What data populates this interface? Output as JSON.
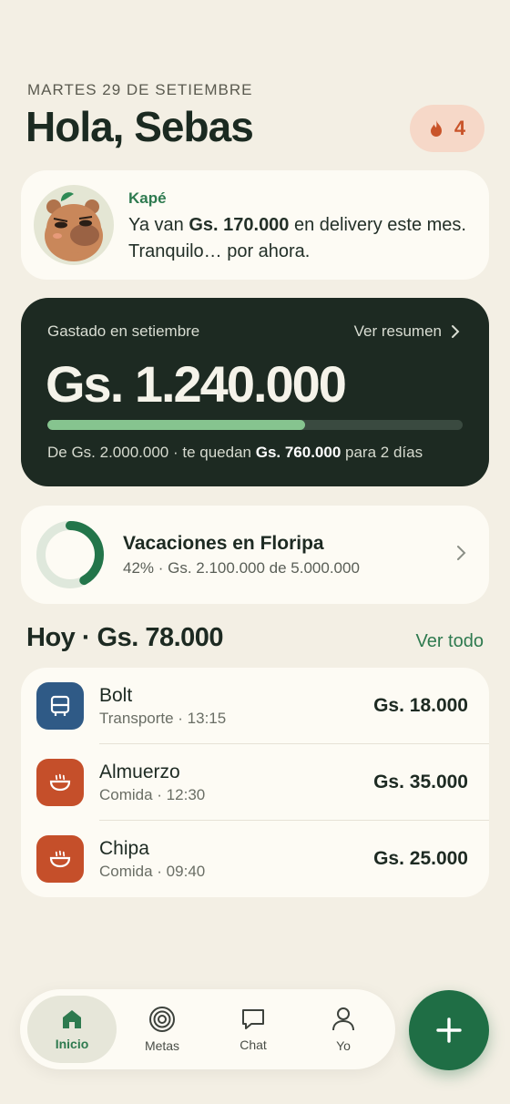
{
  "header": {
    "date": "MARTES 29 DE SETIEMBRE",
    "greeting": "Hola, Sebas",
    "streak_count": "4"
  },
  "kape": {
    "name": "Kapé",
    "msg_pre": "Ya van ",
    "msg_bold": "Gs. 170.000",
    "msg_post": " en delivery este mes. Tranquilo… por ahora."
  },
  "spend": {
    "label": "Gastado en setiembre",
    "link": "Ver resumen",
    "amount": "Gs. 1.240.000",
    "progress": 0.62,
    "foot_pre": "De Gs. 2.000.000 · te quedan ",
    "foot_bold": "Gs. 760.000",
    "foot_post": " para 2 días",
    "colors": {
      "bg": "#1d2a22",
      "fill": "#86c48f"
    }
  },
  "goal": {
    "title": "Vacaciones en Floripa",
    "sub": "42% · Gs. 2.100.000 de 5.000.000",
    "progress": 0.42
  },
  "today": {
    "title": "Hoy · Gs. 78.000",
    "link": "Ver todo",
    "items": [
      {
        "name": "Bolt",
        "meta": "Transporte · 13:15",
        "amount": "Gs. 18.000",
        "icon": "bus-icon",
        "color": "#2f5a86"
      },
      {
        "name": "Almuerzo",
        "meta": "Comida · 12:30",
        "amount": "Gs. 35.000",
        "icon": "bowl-icon",
        "color": "#c54f2a"
      },
      {
        "name": "Chipa",
        "meta": "Comida · 09:40",
        "amount": "Gs. 25.000",
        "icon": "bowl-icon",
        "color": "#c54f2a"
      }
    ]
  },
  "nav": {
    "items": [
      {
        "label": "Inicio",
        "icon": "home-icon"
      },
      {
        "label": "Metas",
        "icon": "target-icon"
      },
      {
        "label": "Chat",
        "icon": "chat-icon"
      },
      {
        "label": "Yo",
        "icon": "user-icon"
      }
    ],
    "active": 0
  },
  "fab": {
    "icon": "plus-icon"
  }
}
